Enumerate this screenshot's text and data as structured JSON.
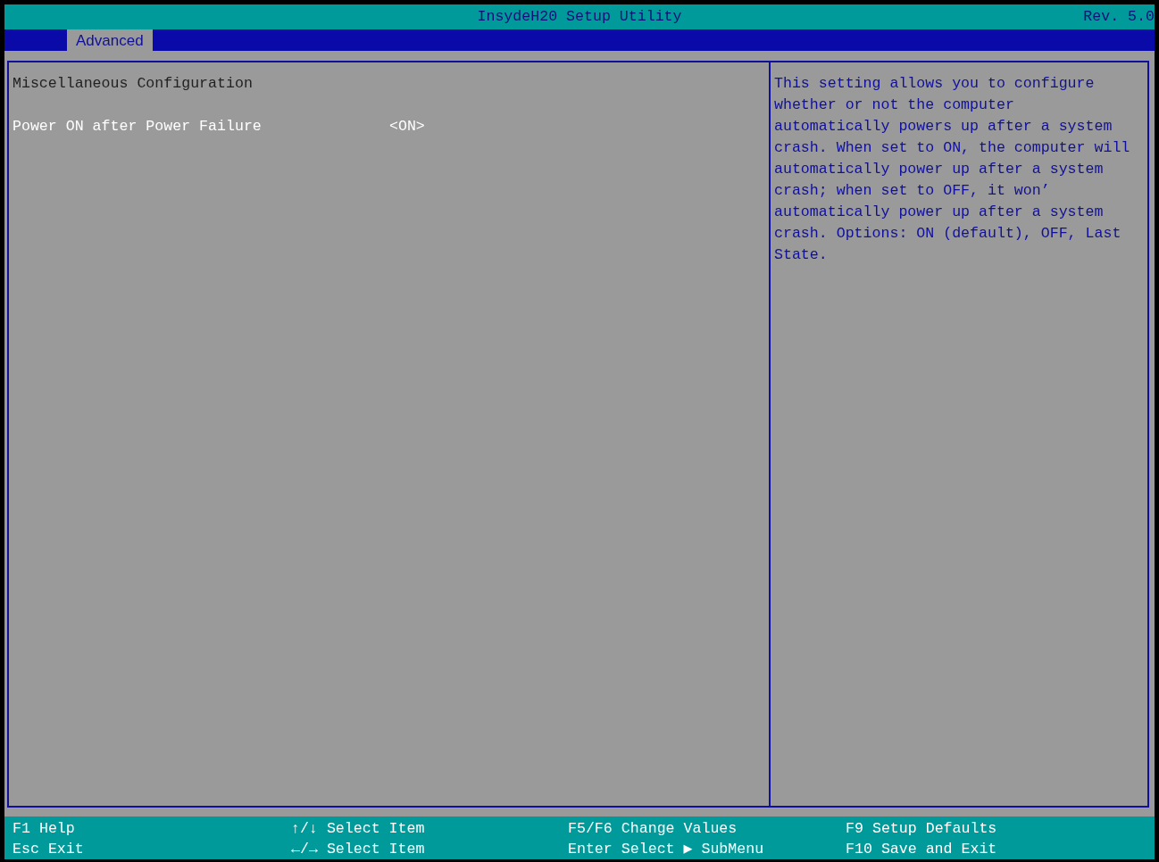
{
  "title_bar": {
    "title": "InsydeH20 Setup Utility",
    "revision": "Rev. 5.0"
  },
  "tabs": [
    {
      "label": "Advanced",
      "selected": true
    }
  ],
  "main_panel": {
    "heading": "Miscellaneous Configuration",
    "items": [
      {
        "label": "Power ON after Power Failure",
        "value": "<ON>",
        "selected": true
      }
    ]
  },
  "help_text": "This setting allows you to configure whether or not the computer automatically powers up after a system crash. When set to ON, the computer will automatically power up after a system crash; when set to OFF, it won’ automatically power up after a system crash. Options: ON (default), OFF, Last State.",
  "footer": [
    {
      "key": "F1",
      "action": "Help"
    },
    {
      "key": "Esc",
      "action": "Exit"
    },
    {
      "key": "↑/↓",
      "action": "Select Item"
    },
    {
      "key": "←/→",
      "action": "Select Item"
    },
    {
      "key": "F5/F6",
      "action": "Change Values"
    },
    {
      "key": "Enter",
      "action": "Select ▶ SubMenu"
    },
    {
      "key": "F9",
      "action": "Setup Defaults"
    },
    {
      "key": "F10",
      "action": "Save and Exit"
    }
  ]
}
